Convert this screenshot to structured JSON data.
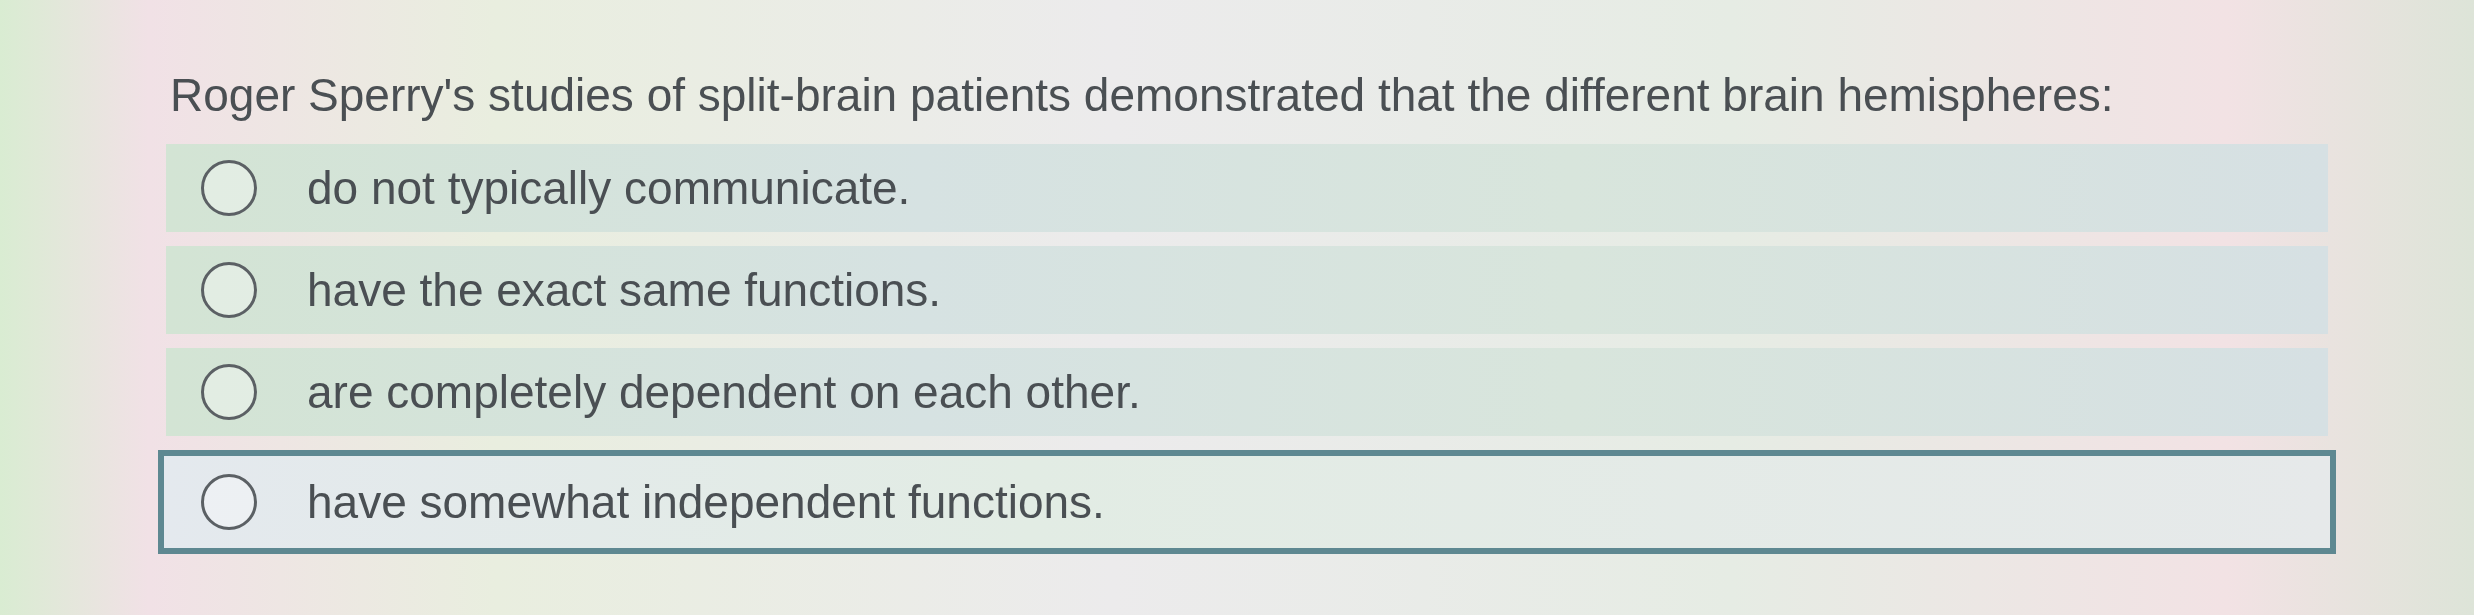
{
  "question": {
    "text": "Roger Sperry's studies of split-brain patients demonstrated that the different brain hemispheres:"
  },
  "options": [
    {
      "label": "do not typically communicate.",
      "selected": false,
      "focused": false
    },
    {
      "label": "have the exact same functions.",
      "selected": false,
      "focused": false
    },
    {
      "label": "are completely dependent on each other.",
      "selected": false,
      "focused": false
    },
    {
      "label": "have somewhat independent functions.",
      "selected": false,
      "focused": true
    }
  ]
}
